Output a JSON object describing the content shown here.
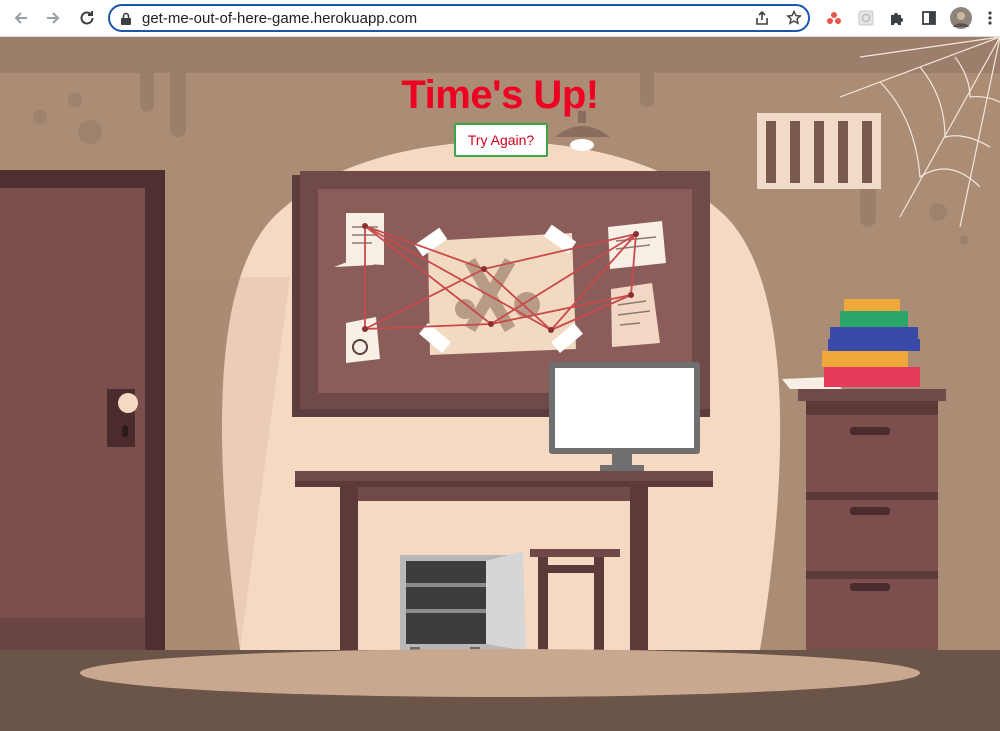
{
  "browser": {
    "url": "get-me-out-of-here-game.herokuapp.com"
  },
  "game": {
    "title": "Time's Up!",
    "retry_label": "Try Again?"
  }
}
